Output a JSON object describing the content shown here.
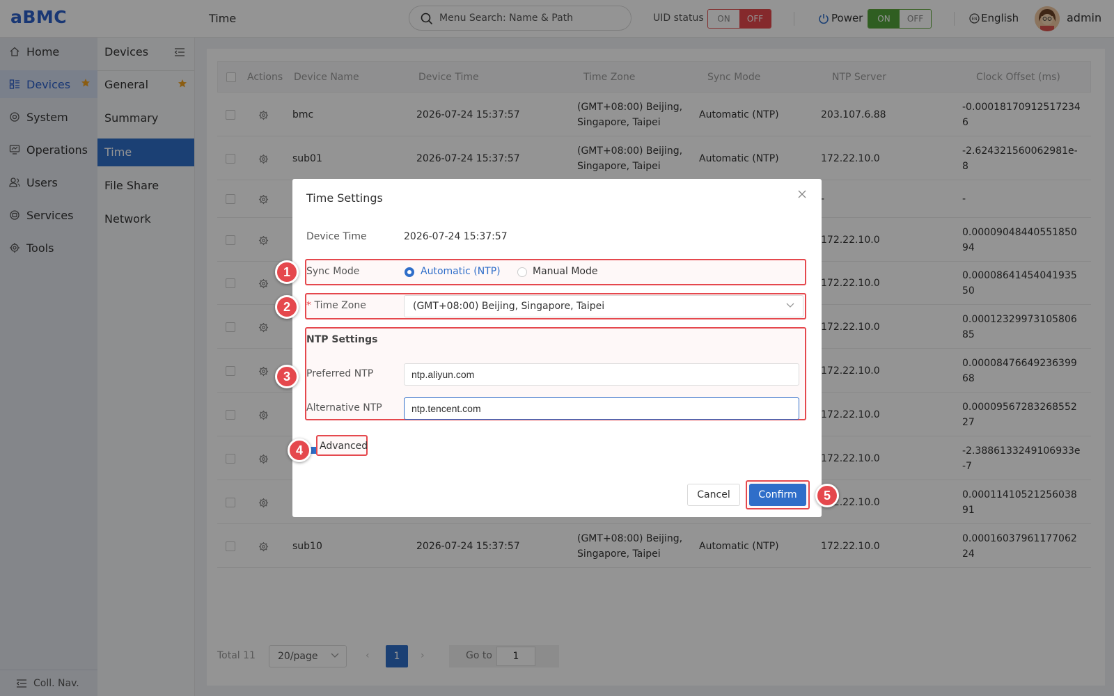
{
  "header": {
    "logo": "aBMC",
    "page_title": "Time",
    "search_placeholder": "Menu Search: Name & Path",
    "uid_status_label": "UID status",
    "uid_on": "ON",
    "uid_off": "OFF",
    "power_label": "Power",
    "power_on": "ON",
    "power_off": "OFF",
    "language": "English",
    "user": "admin"
  },
  "nav": {
    "items": [
      {
        "label": "Home",
        "icon": "home-icon"
      },
      {
        "label": "Devices",
        "icon": "devices-icon",
        "active": true
      },
      {
        "label": "System",
        "icon": "system-icon"
      },
      {
        "label": "Operations",
        "icon": "operations-icon"
      },
      {
        "label": "Users",
        "icon": "users-icon"
      },
      {
        "label": "Services",
        "icon": "services-icon"
      },
      {
        "label": "Tools",
        "icon": "tools-icon"
      }
    ],
    "collapse_label": "Coll. Nav."
  },
  "subnav": {
    "title": "Devices",
    "items": [
      {
        "label": "General"
      },
      {
        "label": "Summary"
      },
      {
        "label": "Time",
        "active": true
      },
      {
        "label": "File Share"
      },
      {
        "label": "Network"
      }
    ]
  },
  "table": {
    "columns": [
      "Actions",
      "Device Name",
      "Device Time",
      "Time Zone",
      "Sync Mode",
      "NTP Server",
      "Clock Offset (ms)"
    ],
    "rows": [
      {
        "name": "bmc",
        "time": "2026-07-24 15:37:57",
        "tz": "(GMT+08:00) Beijing, Singapore, Taipei",
        "sync": "Automatic (NTP)",
        "ntp": "203.107.6.88",
        "offset": "-0.00018170912517234​6"
      },
      {
        "name": "sub01",
        "time": "2026-07-24 15:37:57",
        "tz": "(GMT+08:00) Beijing, Singapore, Taipei",
        "sync": "Automatic (NTP)",
        "ntp": "172.22.10.0",
        "offset": "-2.624321560062981e-8"
      },
      {
        "name": "",
        "time": "",
        "tz": "",
        "sync": "",
        "ntp": "-",
        "offset": "-"
      },
      {
        "name": "",
        "time": "",
        "tz": "",
        "sync": "",
        "ntp": "172.22.10.0",
        "offset": "0.0000904844055185094"
      },
      {
        "name": "",
        "time": "",
        "tz": "",
        "sync": "",
        "ntp": "172.22.10.0",
        "offset": "0.0000864145404193550"
      },
      {
        "name": "",
        "time": "",
        "tz": "",
        "sync": "",
        "ntp": "172.22.10.0",
        "offset": "0.0001232997310580685"
      },
      {
        "name": "",
        "time": "",
        "tz": "",
        "sync": "",
        "ntp": "172.22.10.0",
        "offset": "0.0000847664923639968"
      },
      {
        "name": "",
        "time": "",
        "tz": "",
        "sync": "",
        "ntp": "172.22.10.0",
        "offset": "0.0000956728326855227"
      },
      {
        "name": "",
        "time": "",
        "tz": "",
        "sync": "",
        "ntp": "172.22.10.0",
        "offset": "-2.3886133249106933e-7"
      },
      {
        "name": "",
        "time": "",
        "tz": "",
        "sync": "",
        "ntp": "172.22.10.0",
        "offset": "0.0001141052125603891"
      },
      {
        "name": "sub10",
        "time": "2026-07-24 15:37:57",
        "tz": "(GMT+08:00) Beijing, Singapore, Taipei",
        "sync": "Automatic (NTP)",
        "ntp": "172.22.10.0",
        "offset": "0.0001603796117706224"
      }
    ]
  },
  "pagination": {
    "total": "Total 11",
    "page_size": "20/page",
    "current_page": "1",
    "goto_label": "Go to",
    "goto_value": "1"
  },
  "modal": {
    "title": "Time Settings",
    "device_time_label": "Device Time",
    "device_time_value": "2026-07-24 15:37:57",
    "sync_mode_label": "Sync Mode",
    "sync_auto": "Automatic (NTP)",
    "sync_manual": "Manual Mode",
    "required_mark": "*",
    "time_zone_label": "Time Zone",
    "time_zone_value": "(GMT+08:00) Beijing, Singapore, Taipei",
    "ntp_settings_label": "NTP Settings",
    "preferred_ntp_label": "Preferred NTP",
    "preferred_ntp_value": "ntp.aliyun.com",
    "alternative_ntp_label": "Alternative NTP",
    "alternative_ntp_value": "ntp.tencent.com",
    "advanced_label": "Advanced",
    "cancel_label": "Cancel",
    "confirm_label": "Confirm"
  },
  "annotations": [
    "1",
    "2",
    "3",
    "4",
    "5"
  ],
  "colors": {
    "accent": "#2f6ec9",
    "highlight": "#e5484d",
    "power_on": "#52a33a"
  }
}
